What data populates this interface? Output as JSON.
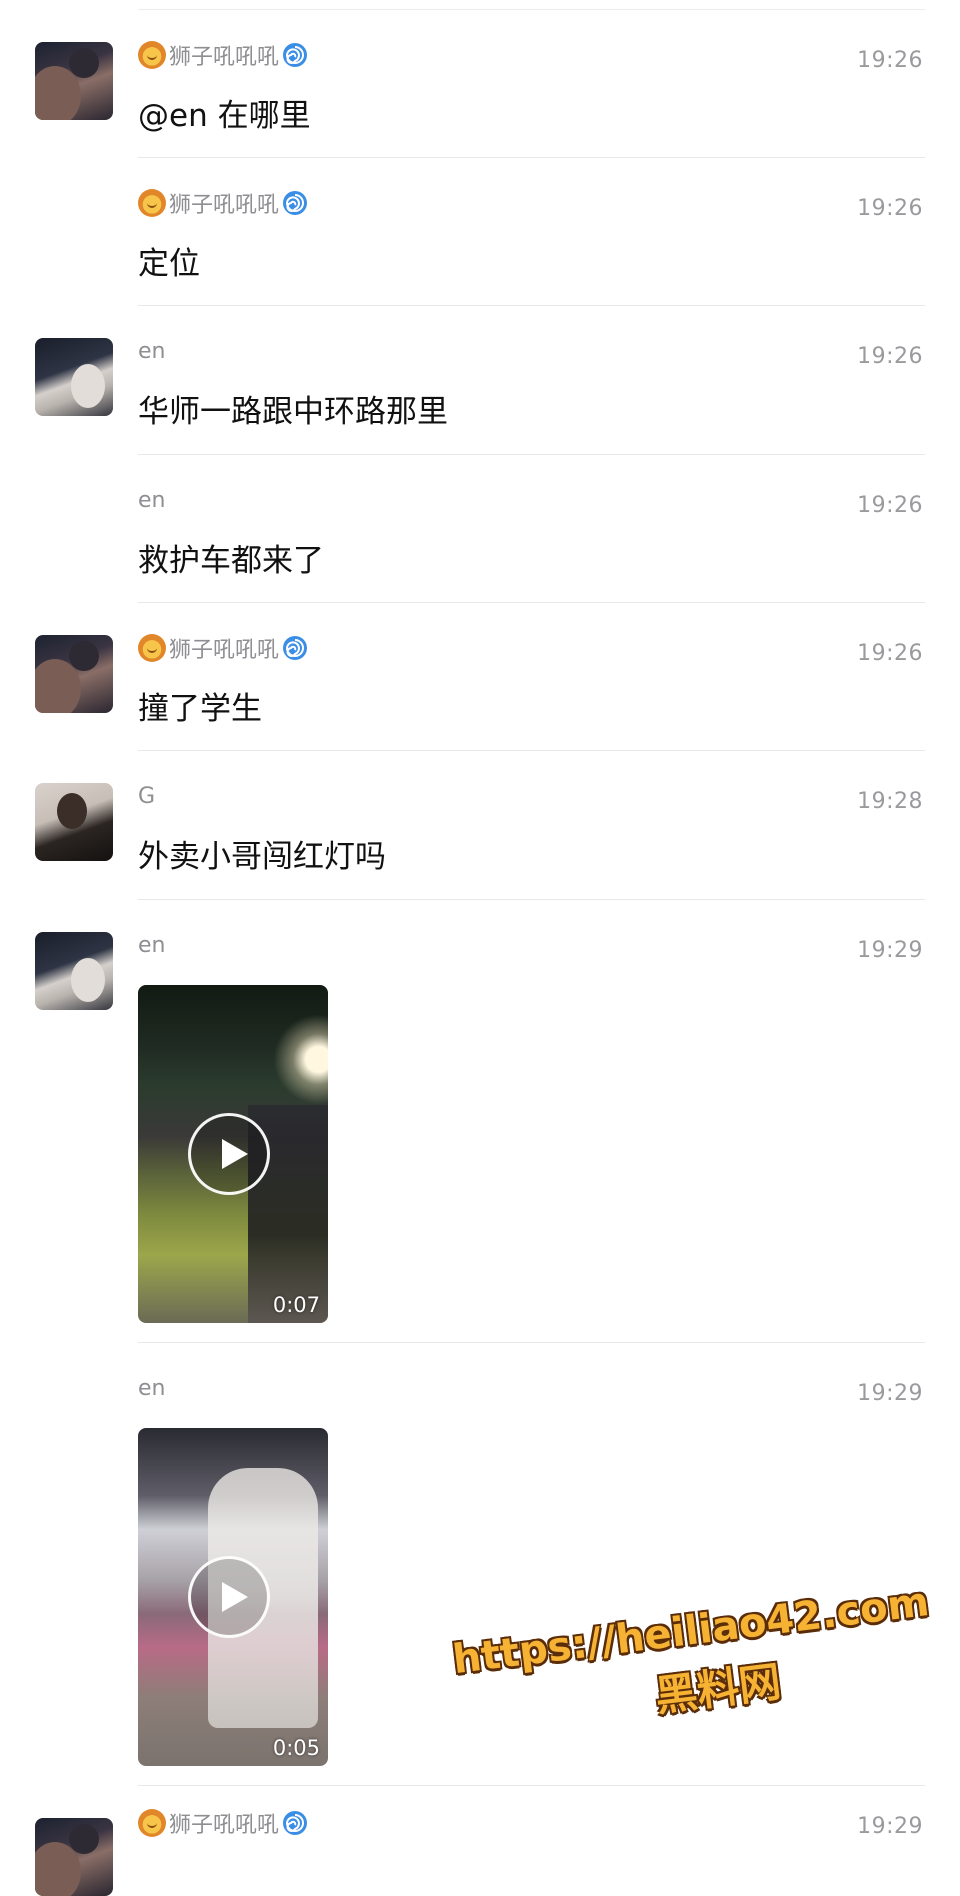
{
  "messages": [
    {
      "sender": "狮子吼吼吼",
      "emoji_sender": true,
      "time": "19:26",
      "text": "@en 在哪里",
      "avatar": "lion-avatar"
    },
    {
      "sender": "狮子吼吼吼",
      "emoji_sender": true,
      "time": "19:26",
      "text": "定位",
      "avatar": null
    },
    {
      "sender": "en",
      "emoji_sender": false,
      "time": "19:26",
      "text": "华师一路跟中环路那里",
      "avatar": "cat-avatar"
    },
    {
      "sender": "en",
      "emoji_sender": false,
      "time": "19:26",
      "text": "救护车都来了",
      "avatar": null
    },
    {
      "sender": "狮子吼吼吼",
      "emoji_sender": true,
      "time": "19:26",
      "text": "撞了学生",
      "avatar": "lion-avatar"
    },
    {
      "sender": "G",
      "emoji_sender": false,
      "time": "19:28",
      "text": "外卖小哥闯红灯吗",
      "avatar": "person-avatar"
    },
    {
      "sender": "en",
      "emoji_sender": false,
      "time": "19:29",
      "video_duration": "0:07",
      "avatar": "cat-avatar"
    },
    {
      "sender": "en",
      "emoji_sender": false,
      "time": "19:29",
      "video_duration": "0:05",
      "avatar": null
    },
    {
      "sender": "狮子吼吼吼",
      "emoji_sender": true,
      "time": "19:29",
      "avatar": "lion-avatar"
    }
  ],
  "watermark": {
    "url": "https://heiliao42.com",
    "name": "黑料网"
  },
  "colors": {
    "name": "#8e8e93",
    "time": "#9a9a9e",
    "text": "#111111",
    "divider": "#e8e8e8",
    "watermark": "#f6b233"
  }
}
